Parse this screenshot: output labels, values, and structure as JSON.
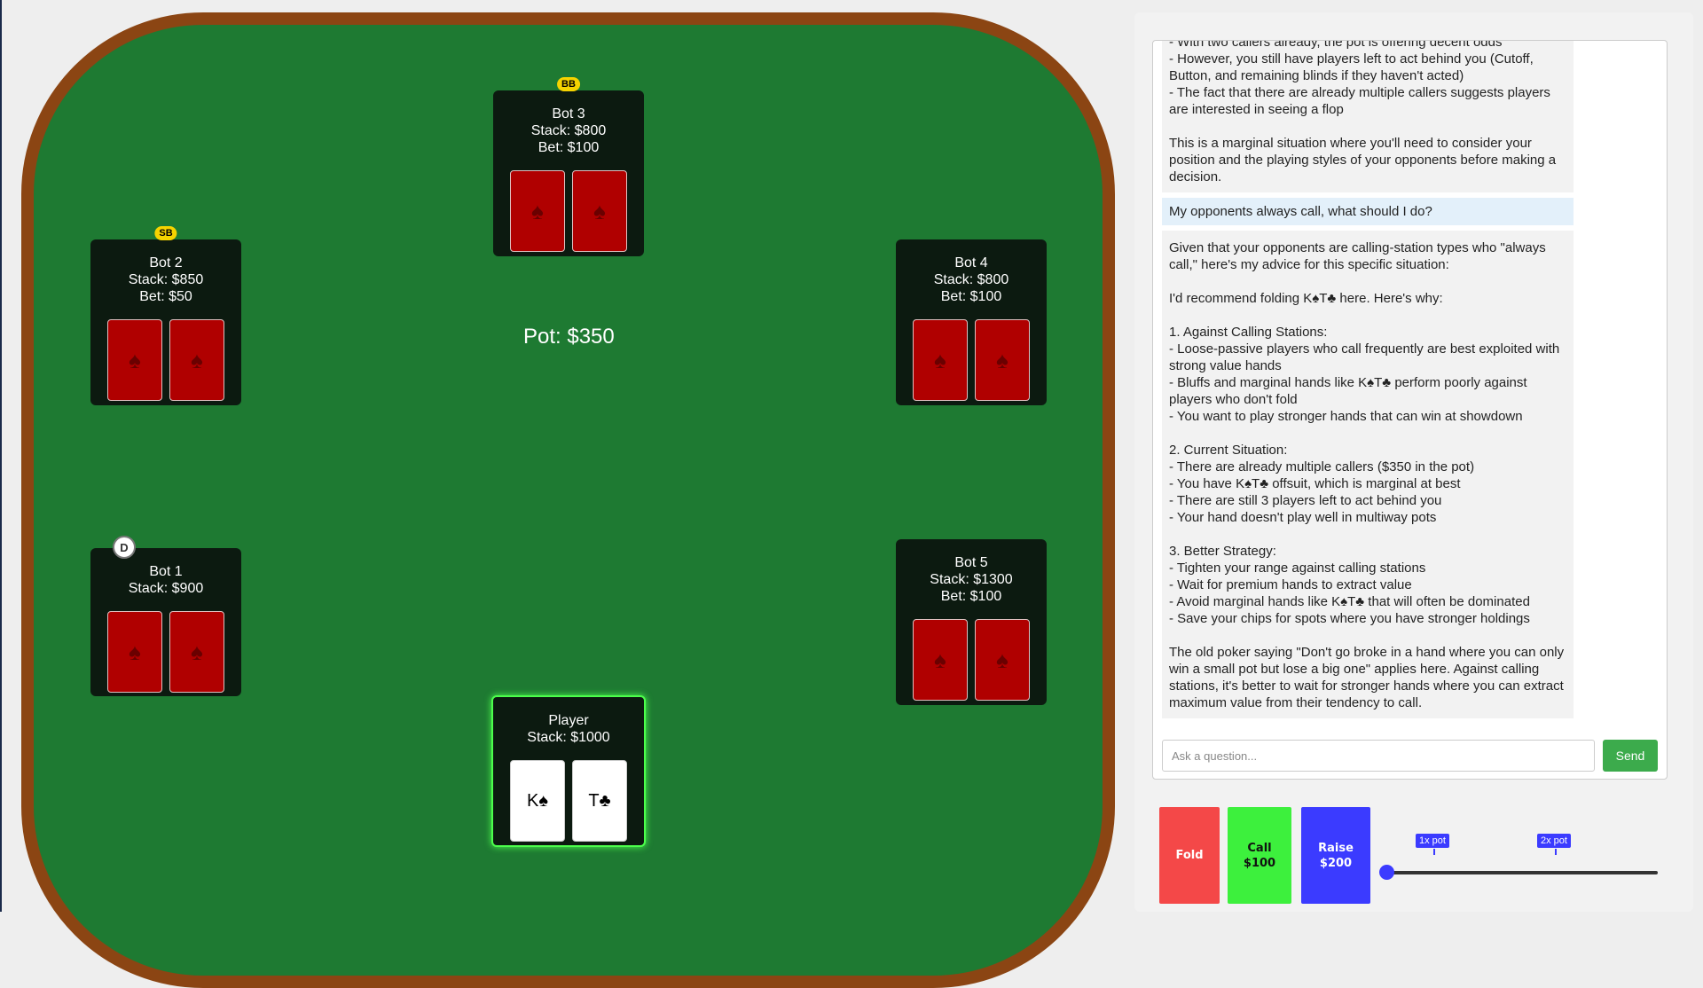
{
  "table": {
    "pot_label": "Pot: $350",
    "seats": [
      {
        "name": "Bot 3",
        "stack": "Stack: $800",
        "bet": "Bet: $100",
        "badge": "BB",
        "card_icon": "spade-icon",
        "card_glyph": "♠"
      },
      {
        "name": "Bot 2",
        "stack": "Stack: $850",
        "bet": "Bet: $50",
        "badge": "SB",
        "card_glyph": "♠"
      },
      {
        "name": "Bot 4",
        "stack": "Stack: $800",
        "bet": "Bet: $100",
        "card_glyph": "♠"
      },
      {
        "name": "Bot 1",
        "stack": "Stack: $900",
        "dealer": "D",
        "card_glyph": "♠"
      },
      {
        "name": "Bot 5",
        "stack": "Stack: $1300",
        "bet": "Bet: $100",
        "card_glyph": "♠"
      }
    ],
    "player": {
      "name": "Player",
      "stack": "Stack: $1000",
      "cards": [
        "K♠",
        "T♣"
      ]
    }
  },
  "chat": {
    "messages": [
      {
        "role": "assistant",
        "text": "- With two callers already, the pot is offering decent odds\n- However, you still have players left to act behind you (Cutoff, Button, and remaining blinds if they haven't acted)\n- The fact that there are already multiple callers suggests players are interested in seeing a flop\n\nThis is a marginal situation where you'll need to consider your position and the playing styles of your opponents before making a decision."
      },
      {
        "role": "user",
        "text": "My opponents always call, what should I do?"
      },
      {
        "role": "assistant",
        "text": "Given that your opponents are calling-station types who \"always call,\" here's my advice for this specific situation:\n\nI'd recommend folding K♠T♣ here. Here's why:\n\n1. Against Calling Stations:\n- Loose-passive players who call frequently are best exploited with strong value hands\n- Bluffs and marginal hands like K♠T♣ perform poorly against players who don't fold\n- You want to play stronger hands that can win at showdown\n\n2. Current Situation:\n- There are already multiple callers ($350 in the pot)\n- You have K♠T♣ offsuit, which is marginal at best\n- There are still 3 players left to act behind you\n- Your hand doesn't play well in multiway pots\n\n3. Better Strategy:\n- Tighten your range against calling stations\n- Wait for premium hands to extract value\n- Avoid marginal hands like K♠T♣ that will often be dominated\n- Save your chips for spots where you have stronger holdings\n\nThe old poker saying \"Don't go broke in a hand where you can only win a small pot but lose a big one\" applies here. Against calling stations, it's better to wait for stronger hands where you can extract maximum value from their tendency to call."
      }
    ],
    "input_placeholder": "Ask a question...",
    "send_label": "Send"
  },
  "actions": {
    "fold_label": "Fold",
    "call_label": "Call",
    "call_amount": "$100",
    "raise_label": "Raise",
    "raise_amount": "$200",
    "slider": {
      "marker_1x": "1x pot",
      "marker_2x": "2x pot",
      "level": 0
    }
  },
  "colors": {
    "felt": "#1e7a32",
    "rail": "#8b4513",
    "fold": "#f44848",
    "call": "#3df03d",
    "raise": "#3b3bff",
    "send": "#3cab4c"
  }
}
